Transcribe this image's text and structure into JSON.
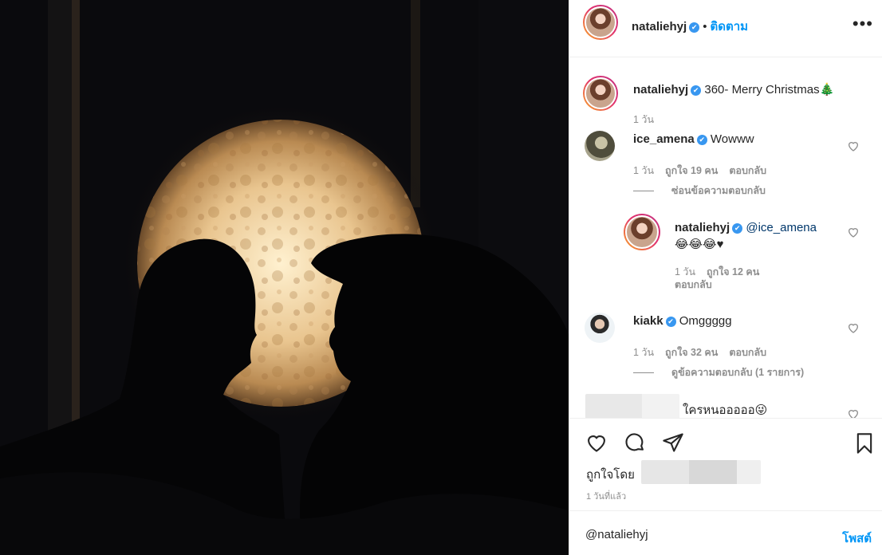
{
  "post": {
    "author": "nataliehyj",
    "follow_dot": "•",
    "follow_label": "ติดตาม",
    "more_label": "•••",
    "photo_description": "Silhouette of two people facing each other in front of a glowing moon lamp"
  },
  "caption": {
    "username": "nataliehyj",
    "text": "360- Merry Christmas🎄",
    "time": "1 วัน"
  },
  "comments": [
    {
      "username": "ice_amena",
      "text": "Wowww",
      "time": "1 วัน",
      "likes": "ถูกใจ 19 คน",
      "reply_label": "ตอบกลับ",
      "thread_label": "ซ่อนข้อความตอบกลับ"
    },
    {
      "username": "nataliehyj",
      "mention": "@ice_amena",
      "text": "😂😂😂♥",
      "time": "1 วัน",
      "likes": "ถูกใจ 12 คน",
      "reply_label": "ตอบกลับ"
    },
    {
      "username": "kiakk",
      "text": "Omggggg",
      "time": "1 วัน",
      "likes": "ถูกใจ 32 คน",
      "reply_label": "ตอบกลับ",
      "thread_label": "ดูข้อความตอบกลับ (1 รายการ)"
    },
    {
      "text": "ใครหนอออออ😜"
    }
  ],
  "actions": {
    "liked_by_label": "ถูกใจโดย",
    "time_ago": "1 วันที่แล้ว"
  },
  "composer": {
    "value": "@nataliehyj",
    "post_label": "โพสต์"
  },
  "colors": {
    "accent": "#0095f6",
    "verified": "#3897f0",
    "muted": "#8e8e8e",
    "text": "#262626"
  }
}
